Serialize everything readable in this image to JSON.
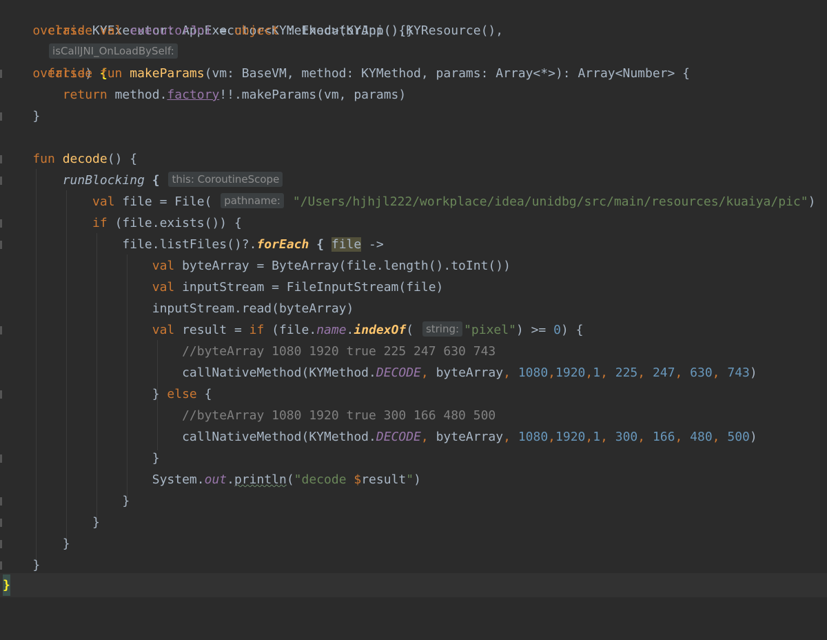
{
  "lines": [
    {
      "t": "class KYExecutor: AppExecutor<KYMethod>(KYApp(),KYResource(), "
    },
    {
      "t": "    override val executorJni = object : ExecutorJni(){}"
    },
    {
      "t": ""
    },
    {
      "t": "    override fun makeParams(vm: BaseVM, method: KYMethod, params: Array<*>): Array<Number> {"
    },
    {
      "t": "        return method.factory!!.makeParams(vm, params)"
    },
    {
      "t": "    }"
    },
    {
      "t": ""
    },
    {
      "t": "    fun decode() {"
    },
    {
      "t": "        runBlocking { "
    },
    {
      "t": "            val file = File( "
    },
    {
      "t": "            if (file.exists()) {"
    },
    {
      "t": "                file.listFiles()?.forEach { file ->"
    },
    {
      "t": "                    val byteArray = ByteArray(file.length().toInt())"
    },
    {
      "t": "                    val inputStream = FileInputStream(file)"
    },
    {
      "t": "                    inputStream.read(byteArray)"
    },
    {
      "t": "                    val result = if (file.name.indexOf( "
    },
    {
      "t": "                        //byteArray 1080 1920 true 225 247 630 743"
    },
    {
      "t": "                        callNativeMethod(KYMethod.DECODE, byteArray, 1080,1920,1, 225, 247, 630, 743)"
    },
    {
      "t": "                    } else {"
    },
    {
      "t": "                        //byteArray 1080 1920 true 300 166 480 500"
    },
    {
      "t": "                        callNativeMethod(KYMethod.DECODE, byteArray, 1080,1920,1, 300, 166, 480, 500)"
    },
    {
      "t": "                    }"
    },
    {
      "t": "                    System.out.println(\"decode $result\")"
    },
    {
      "t": "                }"
    },
    {
      "t": "            }"
    },
    {
      "t": "        }"
    },
    {
      "t": "    }"
    },
    {
      "t": "}"
    }
  ],
  "hints": {
    "is_call_jni": "isCallJNI_OnLoadBySelf:",
    "this_scope": "this: CoroutineScope",
    "pathname": "pathname:",
    "string": "string:"
  },
  "tokens": {
    "class_kw": "class",
    "class_name": " KYExecutor: AppExecutor<KYMethod>(KYApp(),KYResource(),",
    "false_kw": "false",
    "close1": ") ",
    "open_brace": "{",
    "path_str": "\"/Users/hjhjl222/workplace/idea/unidbg/src/main/resources/kuaiya/pic\"",
    "pixel_str": "\"pixel\"",
    "gte": ") >= ",
    "zero": "0",
    "tail": ") {",
    "it_name": "file",
    "arrow": " ->",
    "close_brace": "}"
  },
  "colors": {
    "background": "#2b2b2b",
    "keyword": "#cc7832",
    "function": "#ffc66d",
    "string": "#6a8759",
    "number": "#6897bb",
    "comment": "#808080",
    "property": "#9876aa"
  }
}
